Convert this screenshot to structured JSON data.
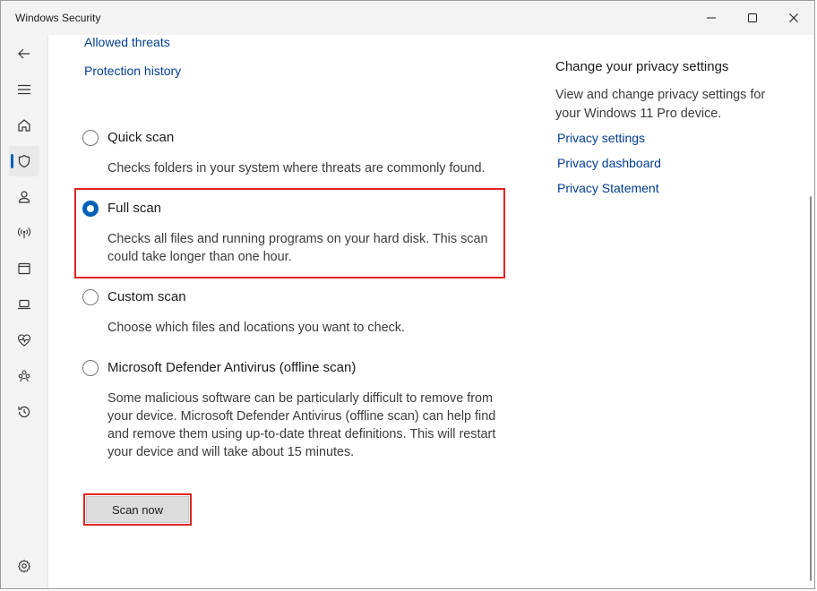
{
  "window": {
    "title": "Windows Security"
  },
  "sidebar": {
    "items": [
      {
        "name": "back-icon"
      },
      {
        "name": "menu-icon"
      },
      {
        "name": "home-icon"
      },
      {
        "name": "shield-icon",
        "active": true
      },
      {
        "name": "account-icon"
      },
      {
        "name": "firewall-network-icon"
      },
      {
        "name": "app-browser-control-icon"
      },
      {
        "name": "device-security-icon"
      },
      {
        "name": "device-health-icon"
      },
      {
        "name": "family-options-icon"
      },
      {
        "name": "protection-history-icon"
      },
      {
        "name": "settings-icon"
      }
    ]
  },
  "main": {
    "links": {
      "allowed_threats": "Allowed threats",
      "protection_history": "Protection history"
    },
    "options": [
      {
        "label": "Quick scan",
        "desc": "Checks folders in your system where threats are commonly found.",
        "checked": false
      },
      {
        "label": "Full scan",
        "desc": "Checks all files and running programs on your hard disk. This scan could take longer than one hour.",
        "checked": true
      },
      {
        "label": "Custom scan",
        "desc": "Choose which files and locations you want to check.",
        "checked": false
      },
      {
        "label": "Microsoft Defender Antivirus (offline scan)",
        "desc": "Some malicious software can be particularly difficult to remove from your device. Microsoft Defender Antivirus (offline scan) can help find and remove them using up-to-date threat definitions. This will restart your device and will take about 15 minutes.",
        "checked": false
      }
    ],
    "scan_button": "Scan now"
  },
  "privacy": {
    "heading": "Change your privacy settings",
    "text": "View and change privacy settings for your Windows 11 Pro device.",
    "links": [
      "Privacy settings",
      "Privacy dashboard",
      "Privacy Statement"
    ]
  },
  "colors": {
    "accent": "#005fb8",
    "link": "#003e92",
    "highlight": "#e32222"
  }
}
